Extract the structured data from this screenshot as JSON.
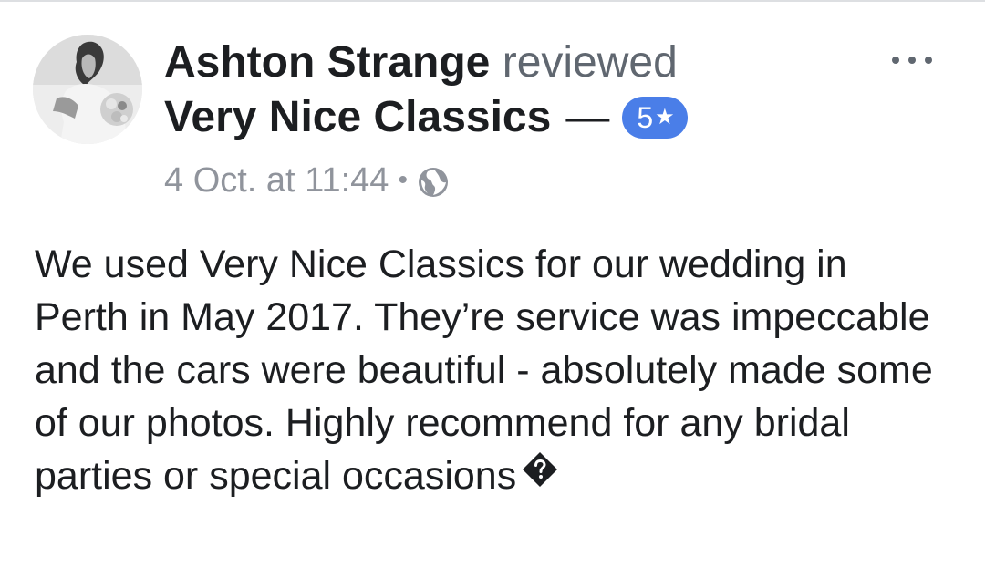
{
  "post": {
    "author": "Ashton Strange",
    "verb": "reviewed",
    "page_name": "Very Nice Classics",
    "dash": "—",
    "rating": {
      "value": "5",
      "star": "★"
    },
    "timestamp": "4 Oct. at 11:44",
    "separator": "•",
    "privacy_icon": "globe-icon",
    "menu_icon": "more-dots-icon",
    "review_text": "We used Very Nice Classics for our wedding in Perth in May 2017. They’re service was impeccable and the cars were beautiful - absolutely made some of our photos. Highly recommend for any bridal parties or special occasions",
    "trailing_glyph": "unknown-character-icon"
  },
  "colors": {
    "badge": "#4a7ee8",
    "secondary_text": "#90949c",
    "primary_text": "#1c1e21"
  }
}
